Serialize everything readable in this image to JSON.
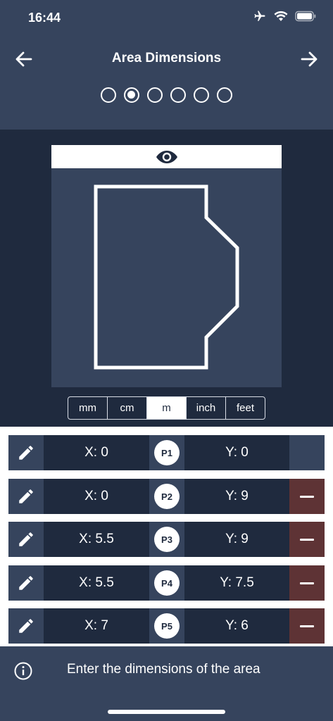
{
  "status_bar": {
    "time": "16:44",
    "icons": [
      "airplane-icon",
      "wifi-icon",
      "battery-icon"
    ]
  },
  "nav": {
    "title": "Area Dimensions",
    "back_icon": "arrow-left-icon",
    "forward_icon": "arrow-right-icon"
  },
  "steps": {
    "count": 6,
    "active_index": 1
  },
  "preview": {
    "icon": "eye-icon"
  },
  "units": {
    "options": [
      "mm",
      "cm",
      "m",
      "inch",
      "feet"
    ],
    "selected": "m"
  },
  "points": [
    {
      "label": "P1",
      "x": "X: 0",
      "y": "Y: 0",
      "removable": false
    },
    {
      "label": "P2",
      "x": "X: 0",
      "y": "Y: 9",
      "removable": true
    },
    {
      "label": "P3",
      "x": "X: 5.5",
      "y": "Y: 9",
      "removable": true
    },
    {
      "label": "P4",
      "x": "X: 5.5",
      "y": "Y: 7.5",
      "removable": true
    },
    {
      "label": "P5",
      "x": "X: 7",
      "y": "Y: 6",
      "removable": true
    }
  ],
  "footer": {
    "icon": "info-icon",
    "message": "Enter the dimensions of the area"
  },
  "colors": {
    "header_bg": "#36445d",
    "page_bg": "#1f2a3e",
    "remove_bg": "#5e3335"
  }
}
